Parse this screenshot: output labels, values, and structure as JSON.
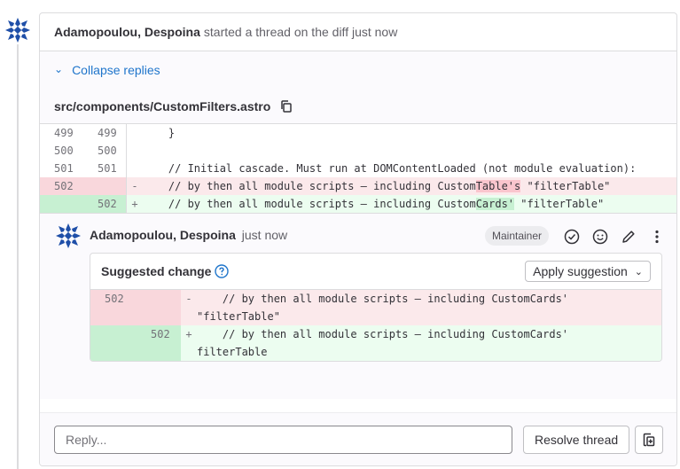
{
  "thread": {
    "author": "Adamopoulou, Despoina",
    "action": "started a thread on the diff just now",
    "collapse_label": "Collapse replies",
    "file_path": "src/components/CustomFilters.astro"
  },
  "diff_lines": [
    {
      "type": "ctx",
      "old": "499",
      "new": "499",
      "sign": "",
      "code": "    }"
    },
    {
      "type": "ctx",
      "old": "500",
      "new": "500",
      "sign": "",
      "code": ""
    },
    {
      "type": "ctx",
      "old": "501",
      "new": "501",
      "sign": "",
      "code": "    // Initial cascade. Must run at DOMContentLoaded (not module evaluation):"
    },
    {
      "type": "del",
      "old": "502",
      "new": "",
      "sign": "-",
      "code_pre": "    // by then all module scripts — including Custom",
      "code_hl": "Table's",
      "code_post": " \"filterTable\""
    },
    {
      "type": "add",
      "old": "",
      "new": "502",
      "sign": "+",
      "code_pre": "    // by then all module scripts — including Custom",
      "code_hl": "Cards'",
      "code_post": " \"filterTable\""
    }
  ],
  "note": {
    "author": "Adamopoulou, Despoina",
    "time": "just now",
    "role_badge": "Maintainer",
    "icons": [
      "resolve-check-icon",
      "emoji-icon",
      "edit-pencil-icon",
      "more-actions-icon"
    ]
  },
  "suggestion": {
    "title": "Suggested change",
    "apply_label": "Apply suggestion",
    "lines": [
      {
        "type": "del",
        "old": "502",
        "new": "",
        "sign": "-",
        "code": "    // by then all module scripts — including CustomCards'\n\"filterTable\""
      },
      {
        "type": "add",
        "old": "",
        "new": "502",
        "sign": "+",
        "code": "    // by then all module scripts — including CustomCards'\nfilterTable"
      }
    ]
  },
  "reply": {
    "placeholder": "Reply...",
    "resolve_label": "Resolve thread"
  },
  "colors": {
    "link": "#1f75cb",
    "del_bg": "#fbe9eb",
    "add_bg": "#ecfdf0",
    "avatar": "#1f4fa8"
  }
}
